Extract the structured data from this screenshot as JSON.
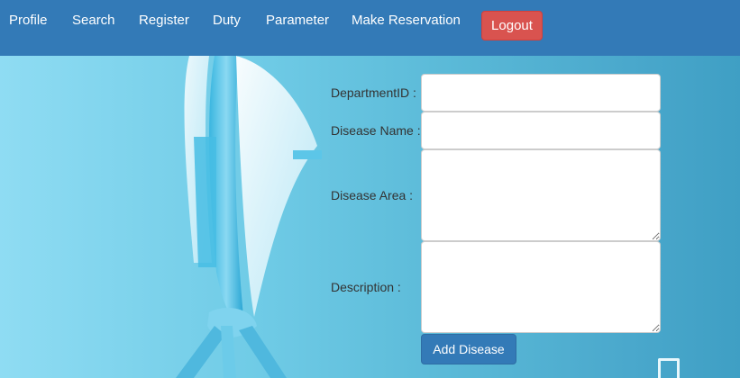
{
  "nav": {
    "items": [
      {
        "label": "Profile"
      },
      {
        "label": "Search"
      },
      {
        "label": "Register"
      },
      {
        "label": "Duty"
      },
      {
        "label": "Parameter"
      },
      {
        "label": "Make Reservation"
      }
    ],
    "logout_label": "Logout"
  },
  "form": {
    "department_id_label": "DepartmentID :",
    "department_id_value": "",
    "disease_name_label": "Disease Name :",
    "disease_name_value": "",
    "disease_area_label": "Disease Area :",
    "disease_area_value": "",
    "description_label": "Description :",
    "description_value": "",
    "submit_label": "Add Disease"
  },
  "colors": {
    "navbar": "#337ab7",
    "logout": "#d9534f",
    "primary_button": "#337ab7"
  }
}
